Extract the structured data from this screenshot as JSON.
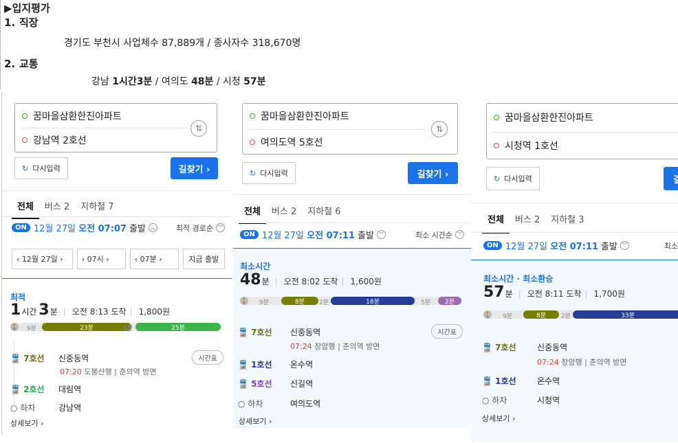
{
  "doc": {
    "title": "▶입지평가",
    "sec1": {
      "num": "1.",
      "label": "직장",
      "text": "경기도 부천시 사업체수 87,889개 / 종사자수 318,670명"
    },
    "sec2": {
      "num": "2.",
      "label": "교통",
      "t1": "강남 ",
      "v1": "1시간3분",
      "t2": " / 여의도 ",
      "v2": "48분",
      "t3": " / 시청 ",
      "v3": "57분"
    }
  },
  "common": {
    "origin": "꿈마을삼환한진아파트",
    "reset": "다시입력",
    "find": "길찾기 ›",
    "tab_all": "전체",
    "on": "ON",
    "depart": "출발",
    "more": "상세보기 ›",
    "timetable": "시간표",
    "alight": "하차"
  },
  "p1": {
    "dest": "강남역 2호선",
    "tab_bus": "버스 2",
    "tab_sub": "지하철 7",
    "date": "12월 27일",
    "time": "오전 07:07",
    "sort": "최적 경로순",
    "sel": [
      "‹  12월 27일  ›",
      "‹  07시  ›",
      "‹  07분  ›"
    ],
    "now": "지금 출발",
    "badge": "최적",
    "d1": "1",
    "u1": "시간",
    "d2": "3",
    "u2": "분",
    "arrive": "오전 8:13 도착",
    "fare": "1,800원",
    "bar": {
      "w1": "9분",
      "s1": "23분",
      "w2": "5분",
      "s2": "25분"
    },
    "steps": [
      {
        "line": "7호선",
        "st": "신중동역"
      },
      {
        "line": "2호선",
        "st": "대림역"
      },
      {
        "st": "강남역"
      }
    ],
    "sub_time": "07:20",
    "sub_dir": "도봉산행",
    "sub_exit": "춘의역 방면"
  },
  "p2": {
    "dest": "여의도역 5호선",
    "tab_bus": "버스 2",
    "tab_sub": "지하철 6",
    "date": "12월 27일",
    "time": "오전 07:11",
    "sort": "최소 시간순",
    "badge": "최소시간",
    "d1": "48",
    "u1": "분",
    "arrive": "오전 8:02 도착",
    "fare": "1,600원",
    "bar": {
      "w1": "9분",
      "s1": "8분",
      "w2": "2분",
      "s2": "18분",
      "w3": "5분",
      "s3": "2분"
    },
    "steps": [
      {
        "line": "7호선",
        "st": "신중동역"
      },
      {
        "line": "1호선",
        "st": "온수역"
      },
      {
        "line": "5호선",
        "st": "신길역"
      },
      {
        "st": "여의도역"
      }
    ],
    "sub_time": "07:24",
    "sub_dir": "장암행",
    "sub_exit": "춘의역 방면"
  },
  "p3": {
    "dest": "시청역 1호선",
    "tab_bus": "버스 2",
    "tab_sub": "지하철 3",
    "date": "12월 27일",
    "time": "오전 07:11",
    "sort": "최소",
    "badge": "최소시간 · 최소환승",
    "d1": "57",
    "u1": "분",
    "arrive": "오전 8:11 도착",
    "fare": "1,700원",
    "bar": {
      "w1": "9분",
      "s1": "8분",
      "w2": "2분",
      "s2": "33분"
    },
    "steps": [
      {
        "line": "7호선",
        "st": "신중동역"
      },
      {
        "line": "1호선",
        "st": "온수역"
      },
      {
        "st": "시청역"
      }
    ],
    "sub_time": "07:24",
    "sub_dir": "장암행",
    "sub_exit": "춘의역 방면",
    "find": "길"
  },
  "colors": {
    "line7": "#747f00",
    "line2": "#3cb44a",
    "line1": "#263c96",
    "line5": "#996cac",
    "accent": "#1a73e8"
  }
}
